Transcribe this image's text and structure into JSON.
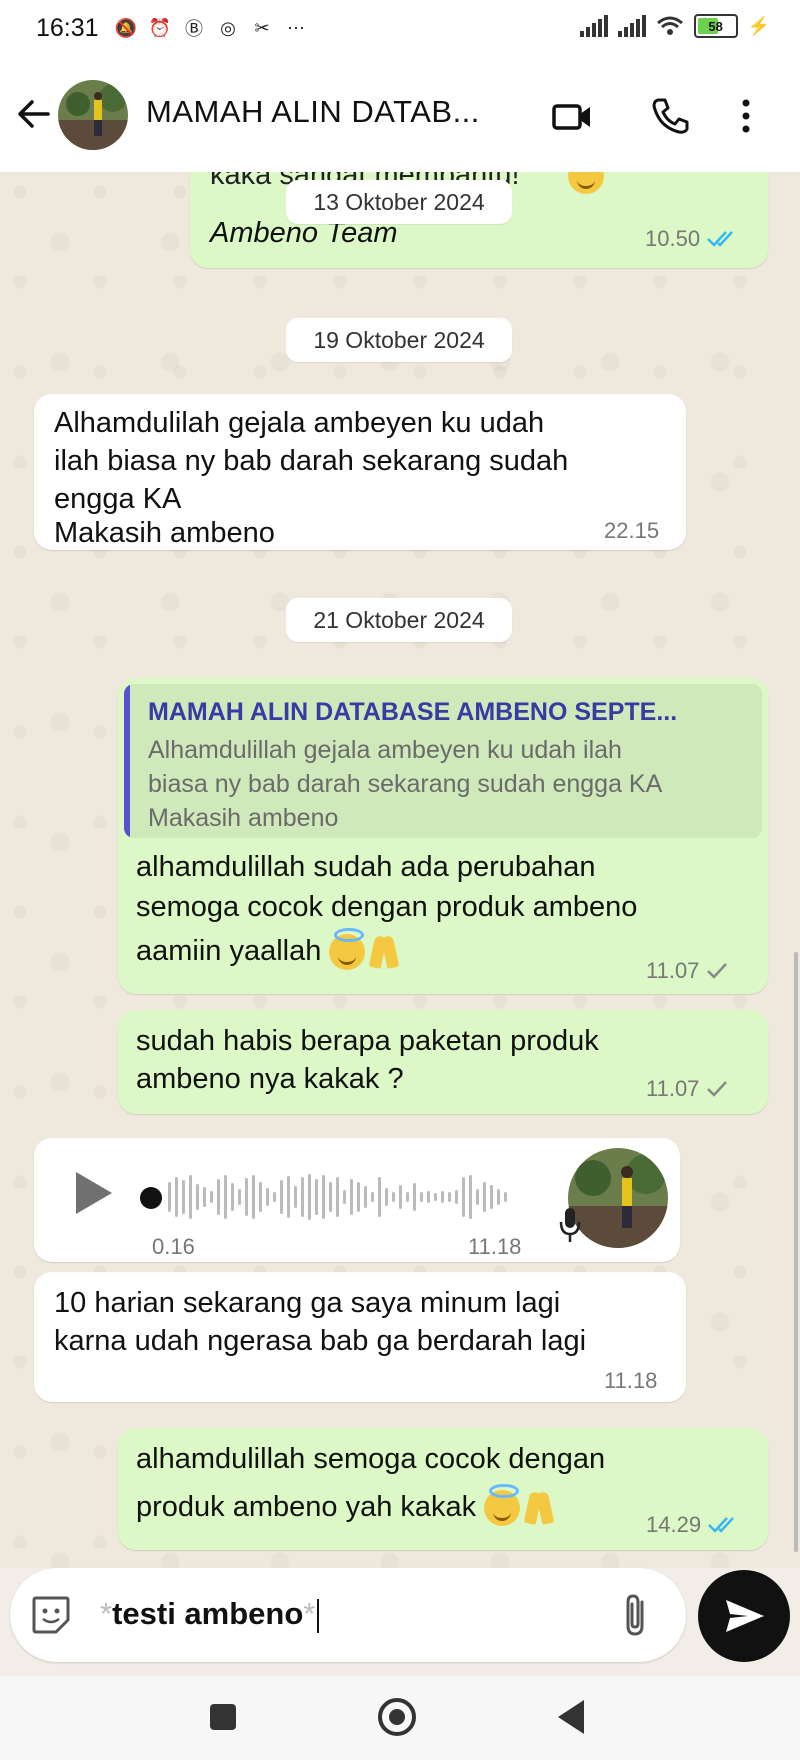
{
  "status_bar": {
    "time": "16:31",
    "battery": "58",
    "battery_level": 0.58
  },
  "header": {
    "back_icon": "arrow-left-icon",
    "contact_name": "MAMAH ALIN DATAB...",
    "video_icon": "video-camera-icon",
    "call_icon": "phone-icon",
    "menu_icon": "more-vertical-icon"
  },
  "chat": {
    "partial_top": {
      "text": "kaka sangat membantu!",
      "date": "13 Oktober 2024",
      "signature": "Ambeno Team",
      "time": "10.50"
    },
    "date_2": "19 Oktober 2024",
    "msg_in_1": {
      "lines": [
        "Alhamdulilah gejala ambeyen ku udah",
        "ilah biasa ny bab darah sekarang sudah",
        "engga KA",
        "Makasih ambeno"
      ],
      "time": "22.15"
    },
    "date_3": "21 Oktober 2024",
    "msg_out_reply": {
      "quote_title": "MAMAH ALIN DATABASE AMBENO SEPTE...",
      "quote_lines": [
        "Alhamdulillah gejala ambeyen ku udah ilah",
        "biasa ny bab darah sekarang sudah engga KA",
        "Makasih ambeno"
      ],
      "lines": [
        "alhamdulillah sudah ada perubahan",
        "semoga cocok dengan produk ambeno",
        "aamiin yaallah"
      ],
      "time": "11.07"
    },
    "msg_out_2": {
      "lines": [
        "sudah habis berapa paketan produk",
        "ambeno nya kakak ?"
      ],
      "time": "11.07"
    },
    "voice_note": {
      "duration": "0.16",
      "time": "11.18",
      "play_icon": "play-icon",
      "mic_icon": "microphone-icon"
    },
    "msg_in_2": {
      "lines": [
        "10 harian sekarang ga saya minum lagi",
        "karna udah ngerasa bab ga berdarah lagi"
      ],
      "time": "11.18"
    },
    "msg_out_3": {
      "lines": [
        "alhamdulillah semoga cocok dengan",
        "produk ambeno yah kakak"
      ],
      "time": "14.29"
    }
  },
  "composer": {
    "text": "testi ambeno",
    "emoji_icon": "sticker-icon",
    "attach_icon": "paperclip-icon",
    "send_icon": "send-icon"
  },
  "colors": {
    "outgoing": "#dcf8c6",
    "incoming": "#ffffff",
    "read_tick": "#34b7f1",
    "quote_bar": "#5b4fd1"
  }
}
